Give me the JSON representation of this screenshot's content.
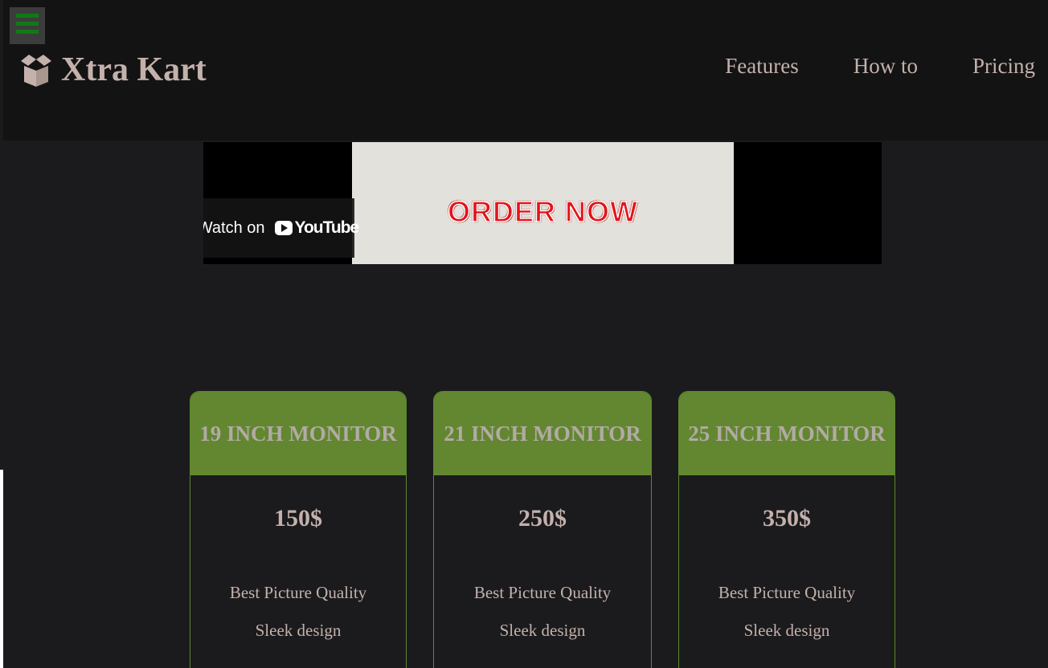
{
  "header": {
    "menu_icon": "hamburger-icon",
    "brand_icon": "open-box-icon",
    "brand_name": "Xtra Kart",
    "nav": [
      {
        "label": "Features"
      },
      {
        "label": "How to"
      },
      {
        "label": "Pricing"
      }
    ]
  },
  "video": {
    "overlay_text": "ORDER NOW",
    "watch_label": "Watch on",
    "youtube_label": "YouTube"
  },
  "pricing": {
    "plans": [
      {
        "title": "19 INCH MONITOR",
        "price": "150$",
        "features": [
          "Best Picture Quality",
          "Sleek design"
        ]
      },
      {
        "title": "21 INCH MONITOR",
        "price": "250$",
        "features": [
          "Best Picture Quality",
          "Sleek design"
        ]
      },
      {
        "title": "25 INCH MONITOR",
        "price": "350$",
        "features": [
          "Best Picture Quality",
          "Sleek design"
        ]
      }
    ]
  },
  "colors": {
    "header_bg": "#131313",
    "page_bg": "#1b1b1d",
    "accent_green": "#628730",
    "text": "#c4b1ac",
    "menu_bar": "#0f7a14"
  }
}
